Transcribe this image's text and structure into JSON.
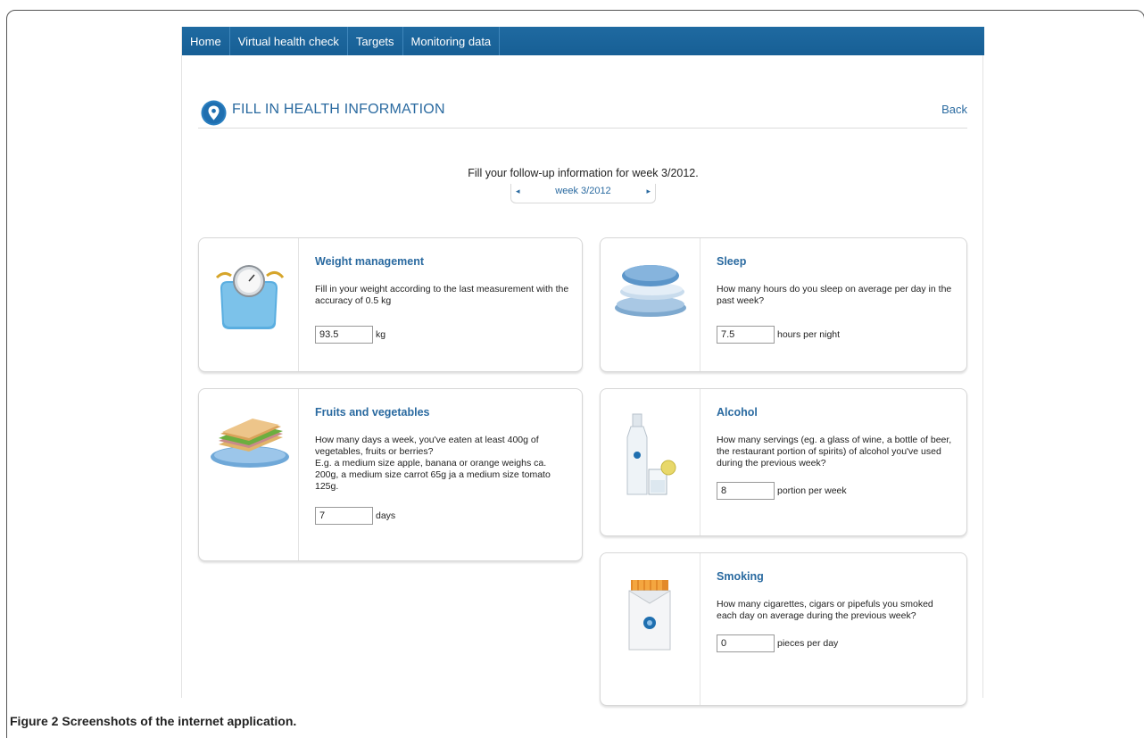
{
  "nav": {
    "items": [
      {
        "label": "Home"
      },
      {
        "label": "Virtual health check"
      },
      {
        "label": "Targets"
      },
      {
        "label": "Monitoring data"
      }
    ]
  },
  "header": {
    "title": "FILL IN HEALTH INFORMATION",
    "back_label": "Back"
  },
  "instruction": "Fill your follow-up information for week 3/2012.",
  "week_selector": {
    "prev": "◂",
    "label": "week 3/2012",
    "next": "▸"
  },
  "cards": {
    "weight": {
      "title": "Weight management",
      "description": "Fill in your weight according to the last measurement with the accuracy of 0.5 kg",
      "value": "93.5",
      "unit": "kg"
    },
    "sleep": {
      "title": "Sleep",
      "description": "How many hours do you sleep on average per day in the past week?",
      "value": "7.5",
      "unit": "hours per night"
    },
    "fruits": {
      "title": "Fruits and vegetables",
      "description_lines": [
        "How many days a week, you've eaten at least 400g of vegetables, fruits or berries?",
        "E.g. a medium size apple, banana or orange weighs ca. 200g, a medium size carrot 65g ja a medium size tomato 125g."
      ],
      "value": "7",
      "unit": "days"
    },
    "alcohol": {
      "title": "Alcohol",
      "description": "How many servings (eg. a glass of wine, a bottle of beer, the restaurant portion of spirits) of alcohol you've used during the previous week?",
      "value": "8",
      "unit": "portion per week"
    },
    "smoking": {
      "title": "Smoking",
      "description": "How many cigarettes, cigars or pipefuls you smoked each day on average during the previous week?",
      "value": "0",
      "unit": "pieces per day"
    }
  },
  "caption": {
    "label": "Figure 2",
    "text": " Screenshots of the internet application."
  },
  "colors": {
    "nav_bg": "#175f95",
    "accent": "#2a6aa0"
  }
}
